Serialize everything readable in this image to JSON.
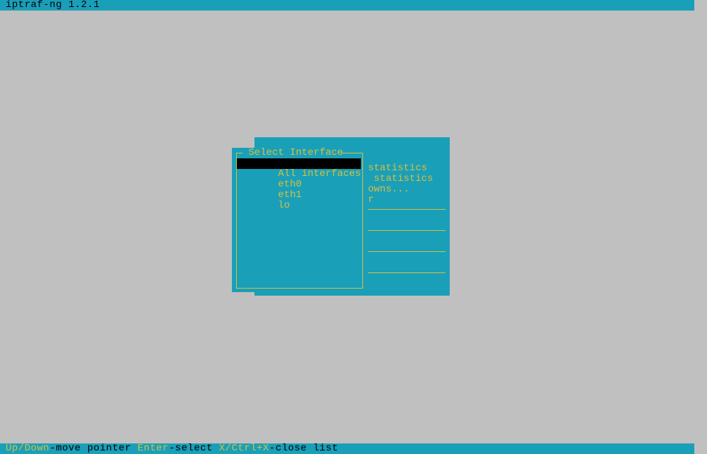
{
  "app": {
    "title": "iptraf-ng 1.2.1"
  },
  "back_menu": {
    "line1": "statistics",
    "line2": " statistics",
    "line3": "owns...",
    "line4": "r"
  },
  "select_dialog": {
    "title": " Select Interface ",
    "items": [
      {
        "label": "All interfaces",
        "selected": true
      },
      {
        "label": "eth0",
        "selected": false
      },
      {
        "label": "eth1",
        "selected": false
      },
      {
        "label": "lo",
        "selected": false
      }
    ]
  },
  "footer": {
    "key1": "Up/Down",
    "sep1": "-",
    "action1": "move pointer",
    "key2": "Enter",
    "sep2": "-",
    "action2": "select",
    "key3": "X/Ctrl+X",
    "sep3": "-",
    "action3": "close list"
  }
}
